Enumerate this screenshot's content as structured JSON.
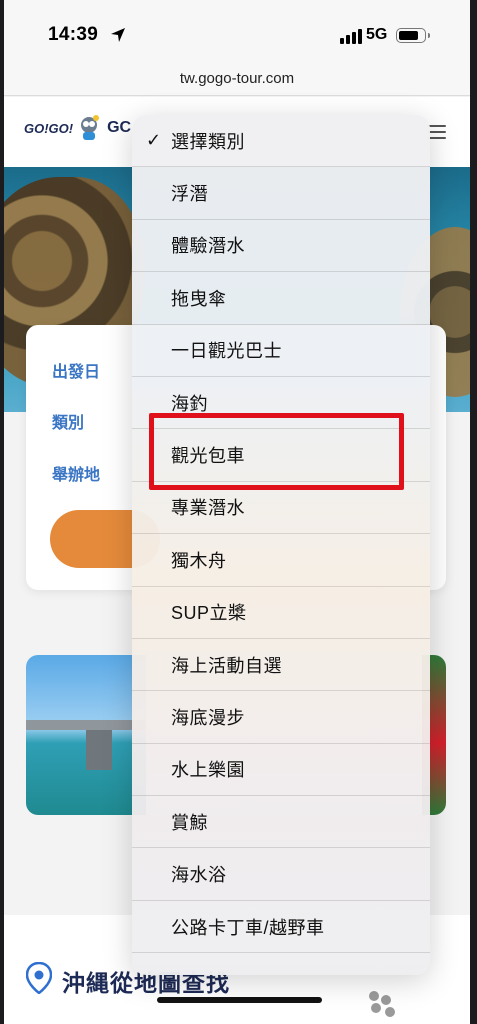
{
  "status_bar": {
    "time": "14:39",
    "network": "5G"
  },
  "browser": {
    "url": "tw.gogo-tour.com"
  },
  "site_header": {
    "logo_text": "GO!GO!",
    "brand_fragment": "GC"
  },
  "search_card": {
    "fields": [
      {
        "label": "出發日"
      },
      {
        "label": "類別"
      },
      {
        "label": "舉辦地"
      }
    ]
  },
  "dropdown": {
    "selected": "選擇類別",
    "options": [
      "選擇類別",
      "浮潛",
      "體驗潛水",
      "拖曳傘",
      "一日觀光巴士",
      "海釣",
      "觀光包車",
      "專業潛水",
      "獨木舟",
      "SUP立槳",
      "海上活動自選",
      "海底漫步",
      "水上樂園",
      "賞鯨",
      "海水浴",
      "公路卡丁車/越野車",
      "…"
    ]
  },
  "bottom": {
    "map_title": "沖縄從地圖查找"
  },
  "colors": {
    "accent_blue": "#3b76c4",
    "accent_orange": "#e58a3a",
    "highlight_red": "#e0101a",
    "brand_navy": "#1d2a55"
  },
  "icons": [
    "location-arrow-icon",
    "signal-icon",
    "battery-icon",
    "hamburger-menu-icon",
    "checkmark-icon",
    "map-pin-icon",
    "dots-icon"
  ]
}
